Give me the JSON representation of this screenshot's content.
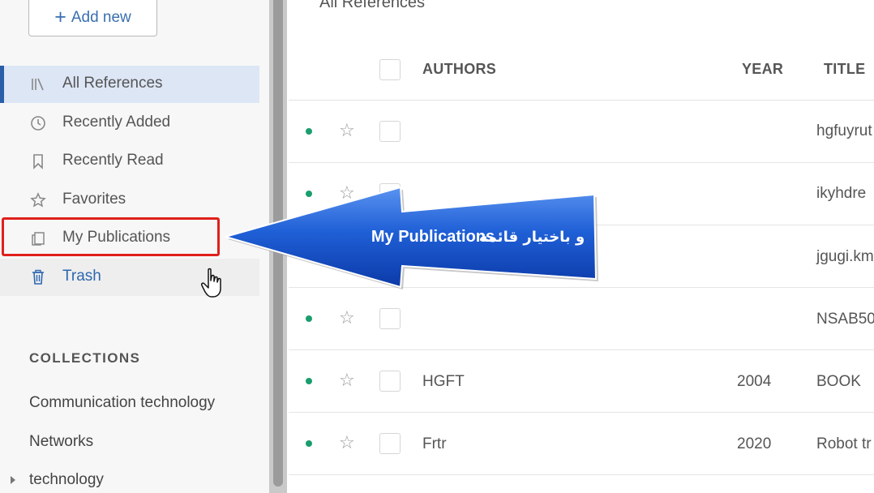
{
  "sidebar": {
    "add_button": "Add new",
    "nav": [
      {
        "label": "All References",
        "icon": "library-icon"
      },
      {
        "label": "Recently Added",
        "icon": "clock-icon"
      },
      {
        "label": "Recently Read",
        "icon": "bookmark-icon"
      },
      {
        "label": "Favorites",
        "icon": "star-icon"
      },
      {
        "label": "My Publications",
        "icon": "publications-icon"
      },
      {
        "label": "Trash",
        "icon": "trash-icon"
      }
    ],
    "collections_title": "COLLECTIONS",
    "collections": [
      "Communication technology",
      "Networks",
      "technology"
    ]
  },
  "main": {
    "title": "All References",
    "columns": {
      "authors": "AUTHORS",
      "year": "YEAR",
      "title": "TITLE"
    },
    "rows": [
      {
        "authors": "",
        "year": "",
        "title": "hgfuyrut"
      },
      {
        "authors": "",
        "year": "",
        "title": "ikyhdre"
      },
      {
        "authors": "",
        "year": "",
        "title": "jgugi.kmi"
      },
      {
        "authors": "",
        "year": "",
        "title": "NSAB50"
      },
      {
        "authors": "HGFT",
        "year": "2004",
        "title": "BOOK"
      },
      {
        "authors": "Frtr",
        "year": "2020",
        "title": "Robot tr"
      }
    ]
  },
  "callout": {
    "text_en": "My Publications",
    "text_ar": "و باختيار قائمة",
    "color": "#1f5fd6"
  },
  "colors": {
    "accent": "#2b5ea8",
    "highlight": "#e0201c",
    "unread_dot": "#1a9e6e"
  }
}
